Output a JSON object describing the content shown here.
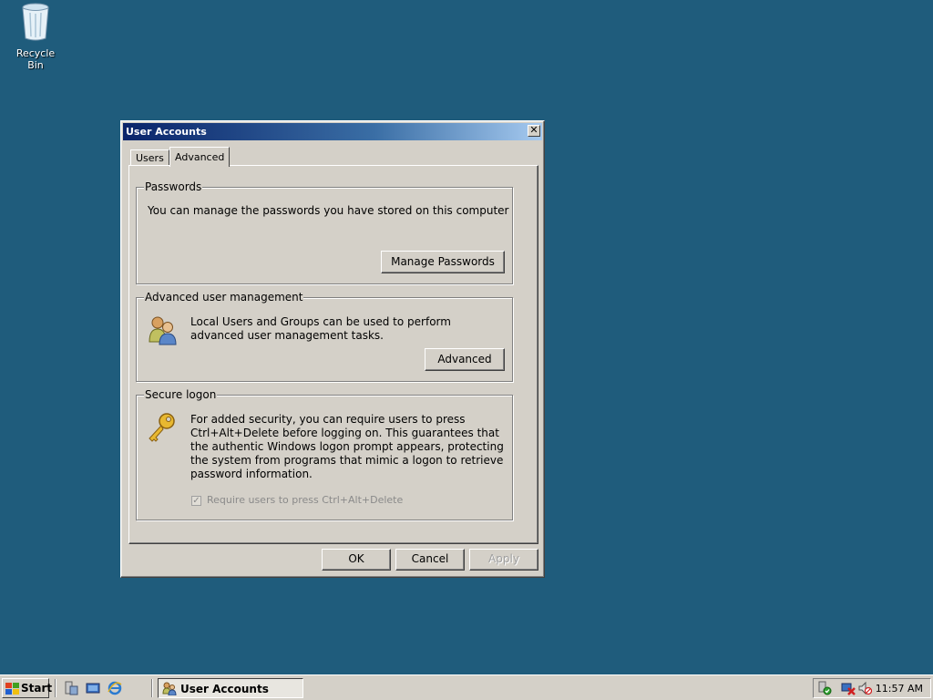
{
  "desktop": {
    "recycle_bin_label": "Recycle Bin"
  },
  "dialog": {
    "title": "User Accounts",
    "close_symbol": "✕",
    "tabs": [
      {
        "label": "Users",
        "selected": false
      },
      {
        "label": "Advanced",
        "selected": true
      }
    ],
    "passwords": {
      "legend": "Passwords",
      "text": "You can manage the passwords you have stored on this computer",
      "button": "Manage Passwords"
    },
    "advanced_user_management": {
      "legend": "Advanced user management",
      "text": "Local Users and Groups can be used to perform advanced user management tasks.",
      "button": "Advanced",
      "icon": "users-icon"
    },
    "secure_logon": {
      "legend": "Secure logon",
      "text": "For added security, you can require users to press Ctrl+Alt+Delete before logging on. This guarantees that the authentic Windows logon prompt appears, protecting the system from programs that mimic a logon to retrieve password information.",
      "checkbox_label": "Require users to press Ctrl+Alt+Delete",
      "checkbox_checked": true,
      "checkbox_enabled": false,
      "icon": "key-icon"
    },
    "buttons": {
      "ok": "OK",
      "cancel": "Cancel",
      "apply": "Apply"
    }
  },
  "taskbar": {
    "start_label": "Start",
    "task_button_label": "User Accounts",
    "clock": "11:57 AM"
  },
  "colors": {
    "desktop": "#1f5c7c",
    "title_gradient_start": "#0a246a",
    "face": "#d4d0c8"
  }
}
